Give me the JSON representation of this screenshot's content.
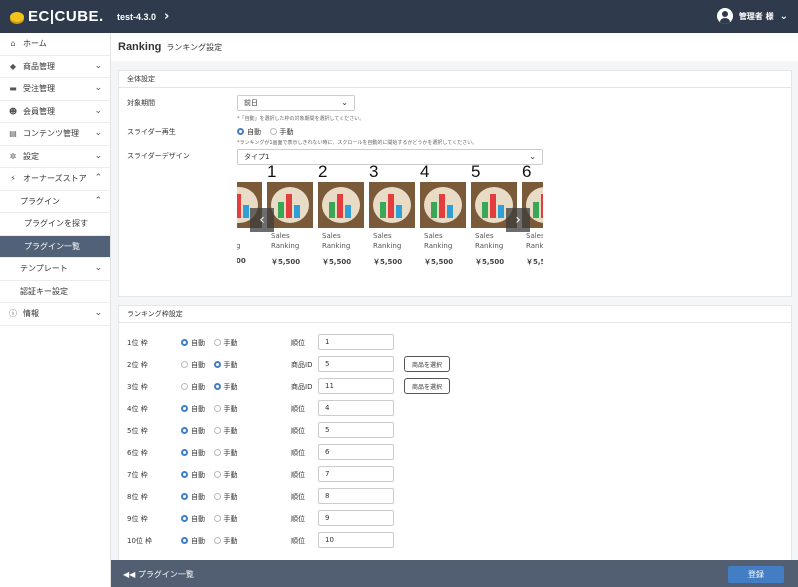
{
  "header": {
    "logo_text": "EC|CUBE.",
    "shop_name": "test-4.3.0",
    "shop_chevron": "›",
    "user_name": "管理者 様",
    "user_chevron": "⌄"
  },
  "sidebar": {
    "items": [
      {
        "icon": "⌂",
        "label": "ホーム"
      },
      {
        "icon": "◆",
        "label": "商品管理",
        "chev": "⌄"
      },
      {
        "icon": "▬",
        "label": "受注管理",
        "chev": "⌄"
      },
      {
        "icon": "☻",
        "label": "会員管理",
        "chev": "⌄"
      },
      {
        "icon": "▤",
        "label": "コンテンツ管理",
        "chev": "⌄"
      },
      {
        "icon": "✲",
        "label": "設定",
        "chev": "⌄"
      },
      {
        "icon": "⚡",
        "label": "オーナーズストア",
        "chev": "⌃"
      },
      {
        "label": "プラグイン",
        "chev": "⌃"
      },
      {
        "label": "プラグインを探す"
      },
      {
        "label": "プラグイン一覧"
      },
      {
        "label": "テンプレート",
        "chev": "⌄"
      },
      {
        "label": "認証キー設定"
      },
      {
        "icon": "ⓘ",
        "label": "情報",
        "chev": "⌄"
      }
    ]
  },
  "page": {
    "title": "Ranking",
    "subtitle": "ランキング設定"
  },
  "general": {
    "heading": "全体設定",
    "period_label": "対象期間",
    "period_value": "前日",
    "period_hint": "*「自動」を選択した枠の対象期間を選択してください。",
    "slider_play_label": "スライダー再生",
    "auto": "自動",
    "manual": "手動",
    "slider_hint": "*ランキングが1画面で表示しきれない時に、スクロールを自動的に開始するかどうかを選択してください。",
    "slider_design_label": "スライダーデザイン",
    "slider_design_value": "タイプ1",
    "chevron": "⌄"
  },
  "slider": {
    "slides": [
      {
        "num": "",
        "t1": "",
        "t2": "g",
        "price": "00"
      },
      {
        "num": "1",
        "t1": "Sales",
        "t2": "Ranking",
        "price": "￥5,500"
      },
      {
        "num": "2",
        "t1": "Sales",
        "t2": "Ranking",
        "price": "￥5,500"
      },
      {
        "num": "3",
        "t1": "Sales",
        "t2": "Ranking",
        "price": "￥5,500"
      },
      {
        "num": "4",
        "t1": "Sales",
        "t2": "Ranking",
        "price": "￥5,500"
      },
      {
        "num": "5",
        "t1": "Sales",
        "t2": "Ranking",
        "price": "￥5,500"
      },
      {
        "num": "6",
        "t1": "Sales",
        "t2": "Rank",
        "price": "￥5,5"
      }
    ],
    "prev": "‹",
    "next": "›"
  },
  "frames": {
    "heading": "ランキング枠設定",
    "auto": "自動",
    "manual": "手動",
    "select_button": "商品を選択",
    "rows": [
      {
        "name": "1位 枠",
        "mode": "auto",
        "field_label": "順位",
        "value": "1"
      },
      {
        "name": "2位 枠",
        "mode": "manual",
        "field_label": "商品ID",
        "value": "5"
      },
      {
        "name": "3位 枠",
        "mode": "manual",
        "field_label": "商品ID",
        "value": "11"
      },
      {
        "name": "4位 枠",
        "mode": "auto",
        "field_label": "順位",
        "value": "4"
      },
      {
        "name": "5位 枠",
        "mode": "auto",
        "field_label": "順位",
        "value": "5"
      },
      {
        "name": "6位 枠",
        "mode": "auto",
        "field_label": "順位",
        "value": "6"
      },
      {
        "name": "7位 枠",
        "mode": "auto",
        "field_label": "順位",
        "value": "7"
      },
      {
        "name": "8位 枠",
        "mode": "auto",
        "field_label": "順位",
        "value": "8"
      },
      {
        "name": "9位 枠",
        "mode": "auto",
        "field_label": "順位",
        "value": "9"
      },
      {
        "name": "10位 枠",
        "mode": "auto",
        "field_label": "順位",
        "value": "10"
      }
    ]
  },
  "footer": {
    "back_icon": "◀◀",
    "back_label": "プラグイン一覧",
    "save_label": "登録"
  },
  "colors": {
    "header_bg": "#2f3b4c",
    "accent": "#437ec4",
    "footer_bg": "#525f73",
    "active_nav": "#516278"
  }
}
